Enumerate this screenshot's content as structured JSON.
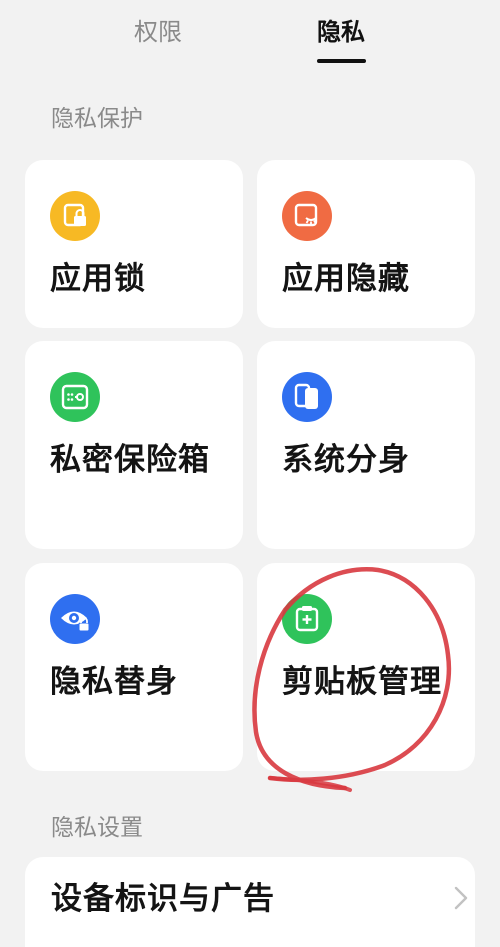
{
  "tabs": {
    "permissions": "权限",
    "privacy": "隐私",
    "active": "privacy"
  },
  "sections": {
    "privacy_protection": "隐私保护",
    "privacy_settings": "隐私设置"
  },
  "cards": [
    {
      "label": "应用锁",
      "icon": "app-lock-icon",
      "color": "#f7b924"
    },
    {
      "label": "应用隐藏",
      "icon": "app-hide-icon",
      "color": "#f06b43"
    },
    {
      "label": "私密保险箱",
      "icon": "private-safe-icon",
      "color": "#2fc35b"
    },
    {
      "label": "系统分身",
      "icon": "system-clone-icon",
      "color": "#2f6ff0"
    },
    {
      "label": "隐私替身",
      "icon": "privacy-substitute-icon",
      "color": "#2f6ff0"
    },
    {
      "label": "剪贴板管理",
      "icon": "clipboard-manager-icon",
      "color": "#2fc35b"
    }
  ],
  "list": {
    "device_id_ads": "设备标识与广告"
  },
  "colors": {
    "background": "#f2f2f2",
    "card": "#ffffff",
    "annotation": "#d8383f"
  }
}
